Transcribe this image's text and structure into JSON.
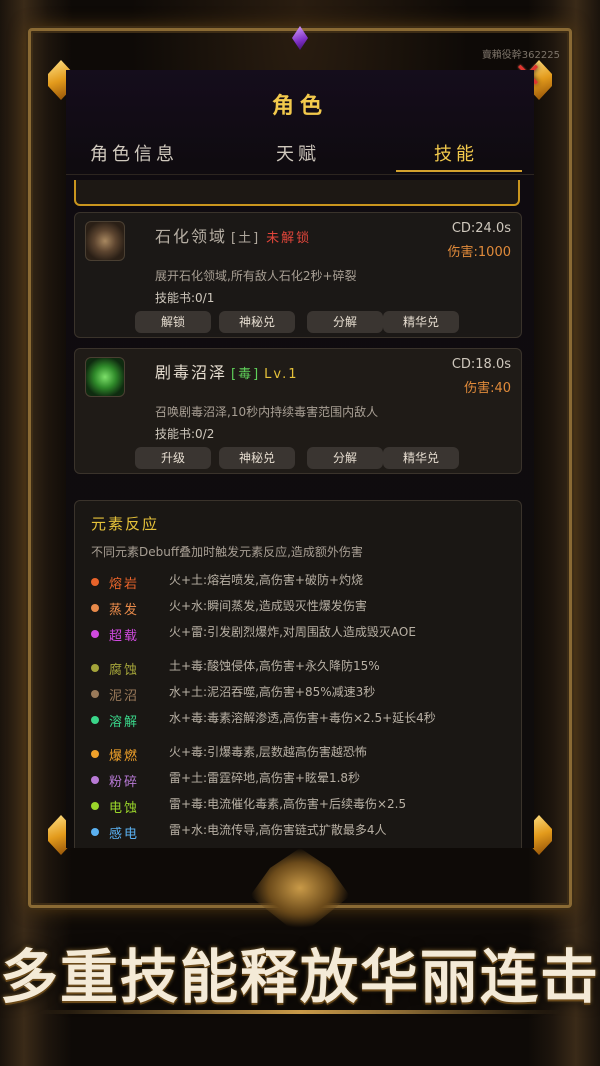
{
  "header": {
    "title": "角色",
    "server_text": "賣賴役幹362225"
  },
  "tabs": [
    "角色信息",
    "天赋",
    "技能"
  ],
  "active_tab": 2,
  "skills": [
    {
      "name": "石化领域",
      "tag": "[土]",
      "status": "未解锁",
      "cd": "CD:24.0s",
      "damage": "伤害:1000",
      "desc": "展开石化领域,所有敌人石化2秒+碎裂",
      "book": "技能书:0/1",
      "buttons": [
        "解锁",
        "神秘兑",
        "分解",
        "精华兑"
      ]
    },
    {
      "name": "剧毒沼泽",
      "tag": "[毒]",
      "level": "Lv.1",
      "cd": "CD:18.0s",
      "damage": "伤害:40",
      "desc": "召唤剧毒沼泽,10秒内持续毒害范围内敌人",
      "book": "技能书:0/2",
      "buttons": [
        "升级",
        "神秘兑",
        "分解",
        "精华兑"
      ]
    }
  ],
  "reaction": {
    "title": "元素反应",
    "intro": "不同元素Debuff叠加时触发元素反应,造成额外伤害",
    "items": [
      {
        "name": "熔岩",
        "color": "#e8632a",
        "desc": "火+土:熔岩喷发,高伤害+破防+灼烧"
      },
      {
        "name": "蒸发",
        "color": "#e88a4a",
        "desc": "火+水:瞬间蒸发,造成毁灭性爆发伤害"
      },
      {
        "name": "超载",
        "color": "#d04adf",
        "desc": "火+雷:引发剧烈爆炸,对周围敌人造成毁灭AOE"
      },
      {
        "name": "腐蚀",
        "color": "#a4a43a",
        "desc": "土+毒:酸蚀侵体,高伤害+永久降防15%"
      },
      {
        "name": "泥沼",
        "color": "#9a7a5a",
        "desc": "水+土:泥沼吞噬,高伤害+85%减速3秒"
      },
      {
        "name": "溶解",
        "color": "#3ad68a",
        "desc": "水+毒:毒素溶解渗透,高伤害+毒伤×2.5+延长4秒"
      },
      {
        "name": "爆燃",
        "color": "#f0a12a",
        "desc": "火+毒:引爆毒素,层数越高伤害越恐怖"
      },
      {
        "name": "粉碎",
        "color": "#b87ad6",
        "desc": "雷+土:雷霆碎地,高伤害+眩晕1.8秒"
      },
      {
        "name": "电蚀",
        "color": "#9ad62a",
        "desc": "雷+毒:电流催化毒素,高伤害+后续毒伤×2.5"
      },
      {
        "name": "感电",
        "color": "#5ab0f0",
        "desc": "雷+水:电流传导,高伤害链式扩散最多4人"
      }
    ]
  },
  "banner": "多重技能释放华丽连击",
  "close_icon": "close-x-icon"
}
